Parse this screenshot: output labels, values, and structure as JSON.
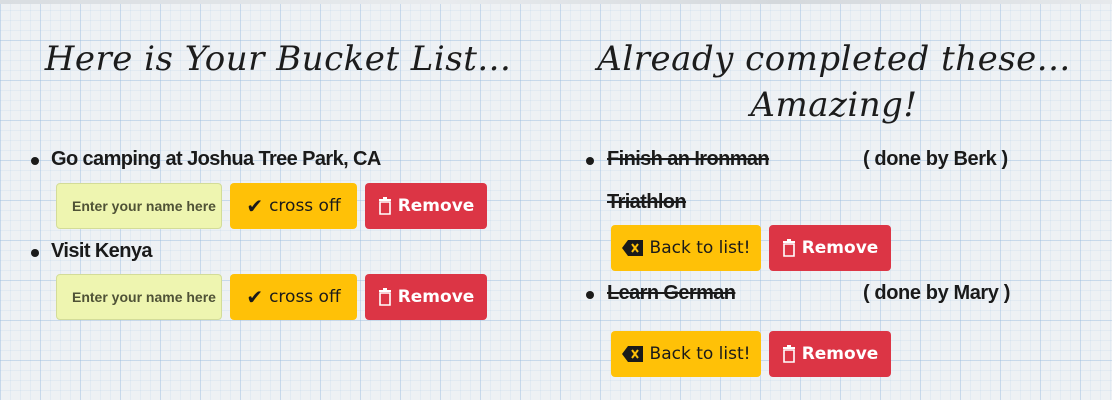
{
  "left": {
    "title": "Here is Your Bucket List...",
    "items": [
      {
        "text": "Go camping at Joshua Tree Park, CA",
        "name_placeholder": "Enter your name here",
        "cross_label": "cross off",
        "remove_label": "Remove"
      },
      {
        "text": "Visit Kenya",
        "name_placeholder": "Enter your name here",
        "cross_label": "cross off",
        "remove_label": "Remove"
      }
    ]
  },
  "right": {
    "title_line1": "Already completed these...",
    "title_line2": "Amazing!",
    "items": [
      {
        "text_line1": "Finish an Ironman",
        "text_line2": "Triathlon",
        "done_by": "( done by Berk )",
        "back_label": "Back to list!",
        "remove_label": "Remove"
      },
      {
        "text_line1": "Learn German",
        "done_by": "( done by Mary )",
        "back_label": "Back to list!",
        "remove_label": "Remove"
      }
    ]
  },
  "colors": {
    "warning": "#ffc107",
    "danger": "#dc3545",
    "input_bg": "#eef5b0"
  },
  "icons": {
    "cross_off": "check-icon",
    "remove": "trash-icon",
    "back": "backspace-icon"
  }
}
